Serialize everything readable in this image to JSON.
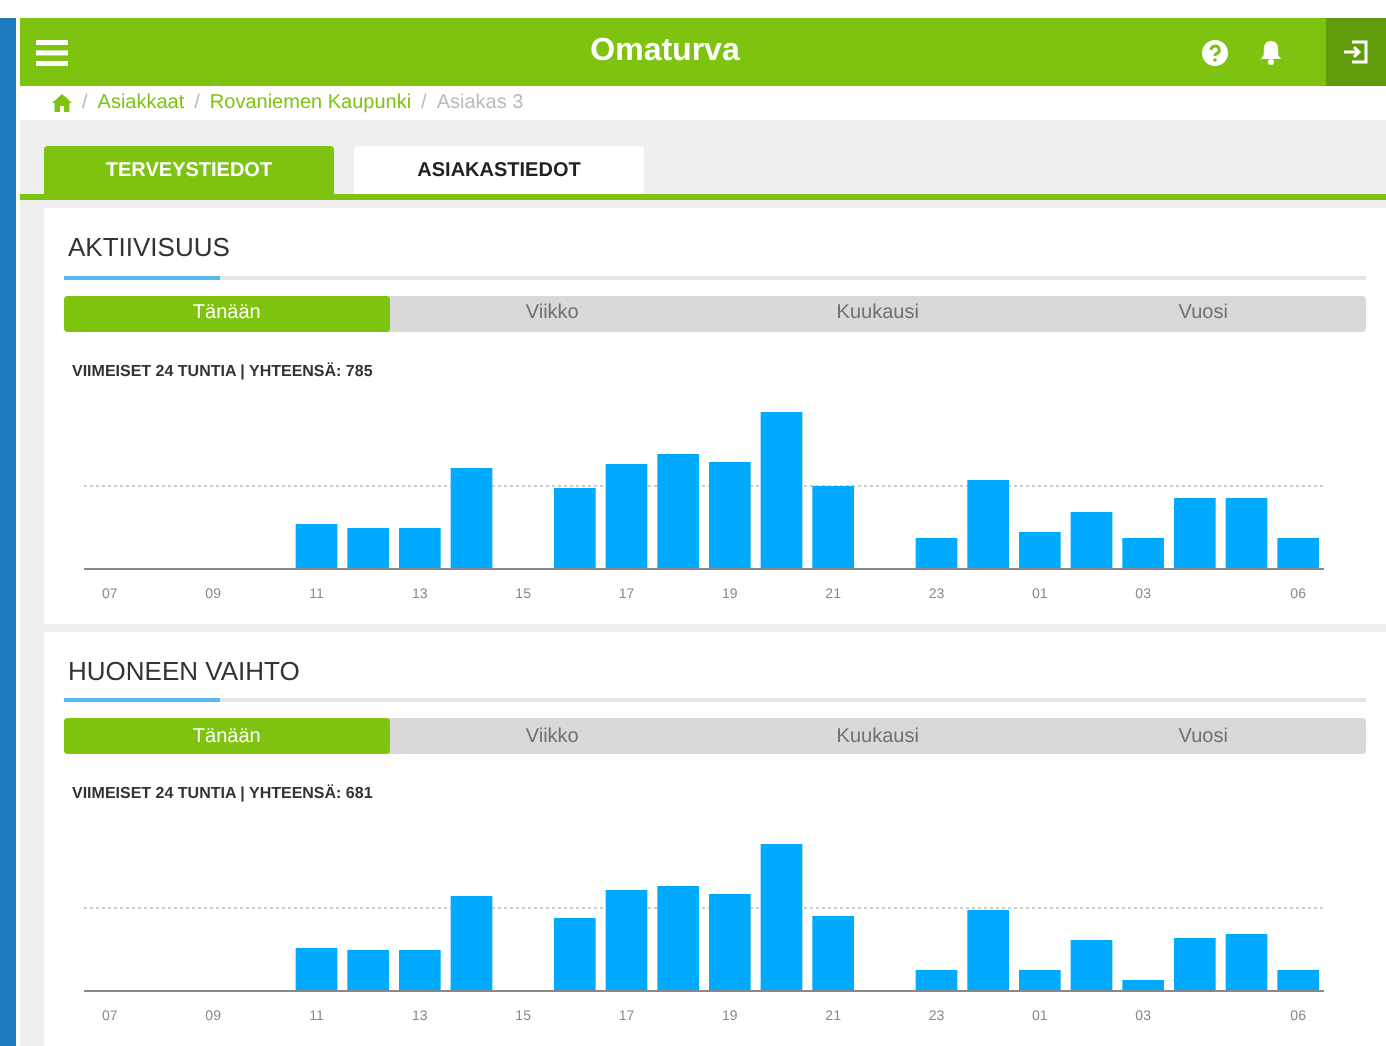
{
  "header": {
    "title": "Omaturva"
  },
  "breadcrumb": [
    {
      "separator": "/",
      "label": "Asiakkaat",
      "kind": "link"
    },
    {
      "separator": "/",
      "label": "Rovaniemen Kaupunki",
      "kind": "link"
    },
    {
      "separator": "/",
      "label": "Asiakas 3",
      "kind": "current"
    }
  ],
  "tabs": [
    {
      "label": "TERVEYSTIEDOT",
      "selected": true
    },
    {
      "label": "ASIAKASTIEDOT",
      "selected": false
    }
  ],
  "panels": [
    {
      "title": "AKTIIVISUUS",
      "periods": [
        {
          "label": "Tänään",
          "selected": true
        },
        {
          "label": "Viikko",
          "selected": false
        },
        {
          "label": "Kuukausi",
          "selected": false
        },
        {
          "label": "Vuosi",
          "selected": false
        }
      ],
      "summary": "VIIMEISET 24 TUNTIA | YHTEENSÄ: 785",
      "x_labels": [
        "07",
        "09",
        "11",
        "13",
        "15",
        "17",
        "19",
        "21",
        "23",
        "01",
        "03",
        "06"
      ]
    },
    {
      "title": "HUONEEN VAIHTO",
      "periods": [
        {
          "label": "Tänään",
          "selected": true
        },
        {
          "label": "Viikko",
          "selected": false
        },
        {
          "label": "Kuukausi",
          "selected": false
        },
        {
          "label": "Vuosi",
          "selected": false
        }
      ],
      "summary": "VIIMEISET 24 TUNTIA | YHTEENSÄ: 681",
      "x_labels": [
        "07",
        "09",
        "11",
        "13",
        "15",
        "17",
        "19",
        "21",
        "23",
        "01",
        "03",
        "06"
      ]
    }
  ]
}
